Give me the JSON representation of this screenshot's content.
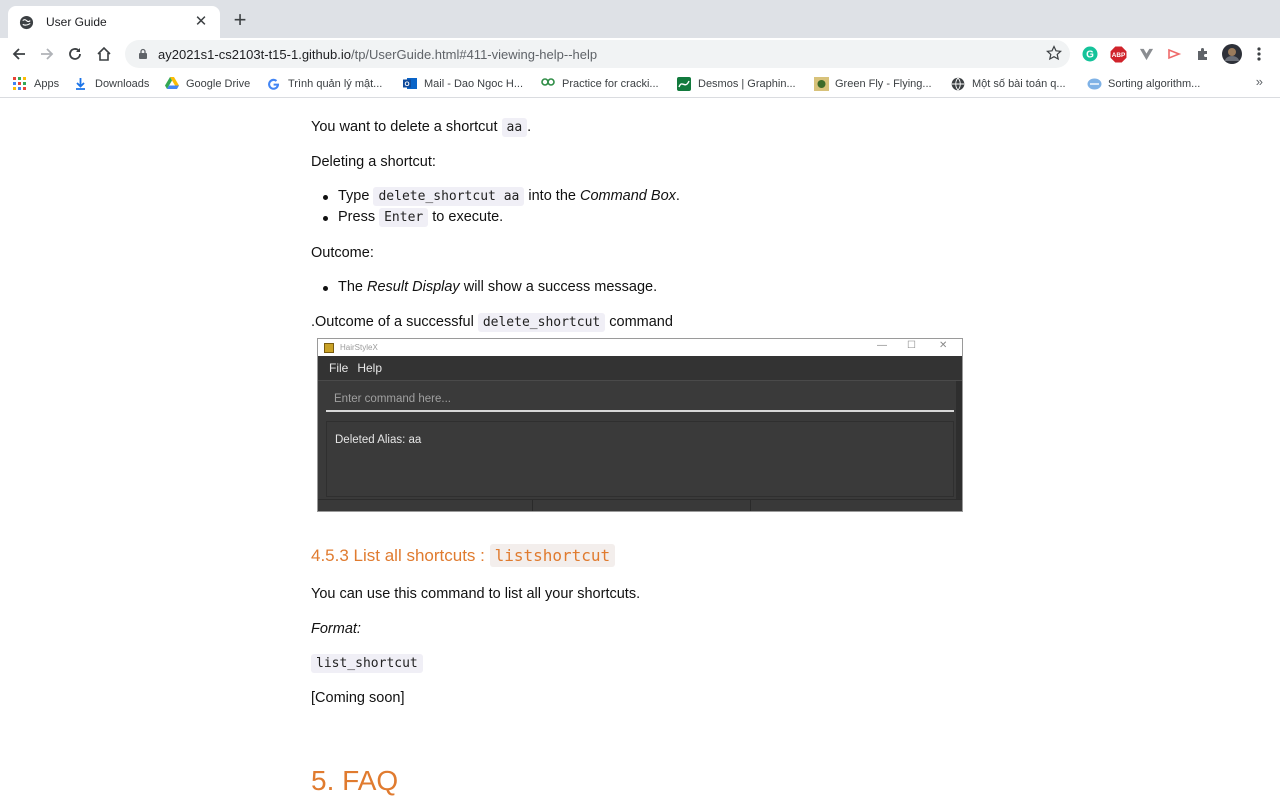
{
  "browser": {
    "tab_title": "User Guide",
    "url_host": "ay2021s1-cs2103t-t15-1.github.io",
    "url_path": "/tp/UserGuide.html#411-viewing-help--help",
    "bookmarks": [
      {
        "label": "Apps",
        "icon": "apps-grid-icon"
      },
      {
        "label": "Downloads",
        "icon": "download-icon"
      },
      {
        "label": "Google Drive",
        "icon": "google-drive-icon"
      },
      {
        "label": "Trình quản lý mật...",
        "icon": "google-g-icon"
      },
      {
        "label": "Mail - Dao Ngoc H...",
        "icon": "outlook-icon"
      },
      {
        "label": "Practice for cracki...",
        "icon": "practice-icon"
      },
      {
        "label": "Desmos | Graphin...",
        "icon": "desmos-icon"
      },
      {
        "label": "Green Fly - Flying...",
        "icon": "green-fly-icon"
      },
      {
        "label": "Một số bài toán q...",
        "icon": "globe-icon"
      },
      {
        "label": "Sorting algorithm...",
        "icon": "sorting-icon"
      }
    ],
    "bookmarks_more": "»"
  },
  "content": {
    "intro": {
      "before": "You want to delete a shortcut ",
      "code": "aa",
      "after": "."
    },
    "steps_heading": "Deleting a shortcut:",
    "step1": {
      "before": "Type ",
      "code": "delete_shortcut aa",
      "mid": " into the ",
      "em": "Command Box",
      "after": "."
    },
    "step2": {
      "before": "Press ",
      "code": "Enter",
      "after": " to execute."
    },
    "outcome_heading": "Outcome:",
    "outcome1": {
      "before": "The ",
      "em": "Result Display",
      "after": " will show a success message."
    },
    "caption": {
      "before": ".Outcome of a successful ",
      "code": "delete_shortcut",
      "after": " command"
    },
    "section_heading": {
      "text": "4.5.3 List all shortcuts : ",
      "code": "listshortcut"
    },
    "section_desc": "You can use this command to list all your shortcuts.",
    "format_label": "Format:",
    "format_code": "list_shortcut",
    "coming_soon": "[Coming soon]",
    "faq_heading": "5. FAQ"
  },
  "app_screenshot": {
    "window_title": "HairStyleX",
    "menus": [
      "File",
      "Help"
    ],
    "command_placeholder": "Enter command here...",
    "result_text": "Deleted Alias: aa"
  },
  "colors": {
    "heading_accent": "#e07b2f",
    "code_background": "#f0eff6",
    "app_background": "#3a3a3a"
  }
}
